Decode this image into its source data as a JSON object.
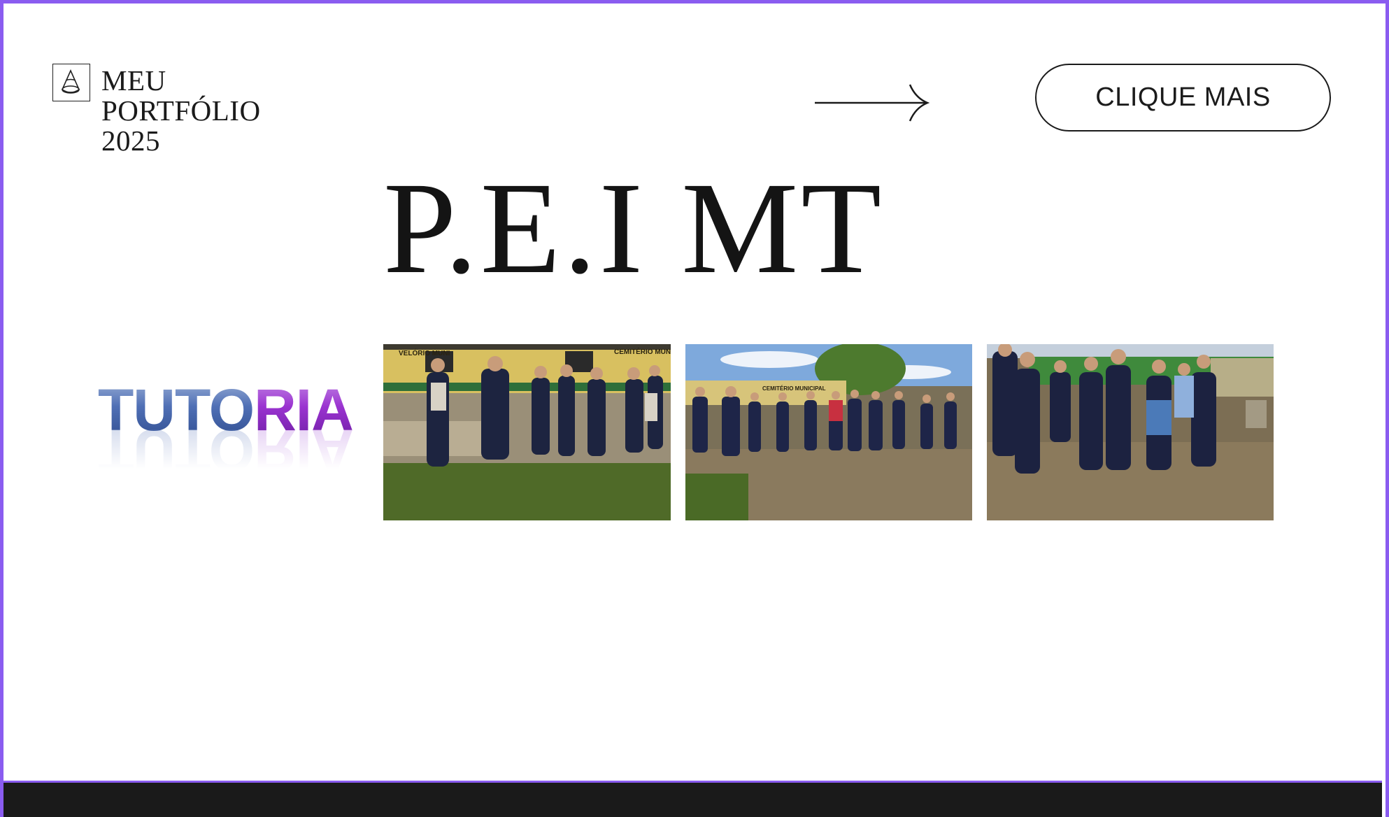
{
  "header": {
    "logo_lines": [
      "MEU",
      "PORTFÓLIO",
      "2025"
    ],
    "cta_label": "CLIQUE MAIS",
    "arrow_icon": "long-arrow-right-icon"
  },
  "hero": {
    "title": "P.E.I MT"
  },
  "badge": {
    "text_part1": "TUTO",
    "text_part2": "RIA",
    "color_part1": "#3f5fa8",
    "color_part2": "#8d2bc4"
  },
  "photos": [
    {
      "sign_left": "VELÓRIO MUNI",
      "sign_right": "CEMITÉRIO MUNICIP"
    },
    {
      "sign_left": "CEMITÉRIO MUNICIPAL"
    },
    {}
  ],
  "colors": {
    "frame": "#8a5cf0",
    "footer": "#1a1a1a"
  }
}
